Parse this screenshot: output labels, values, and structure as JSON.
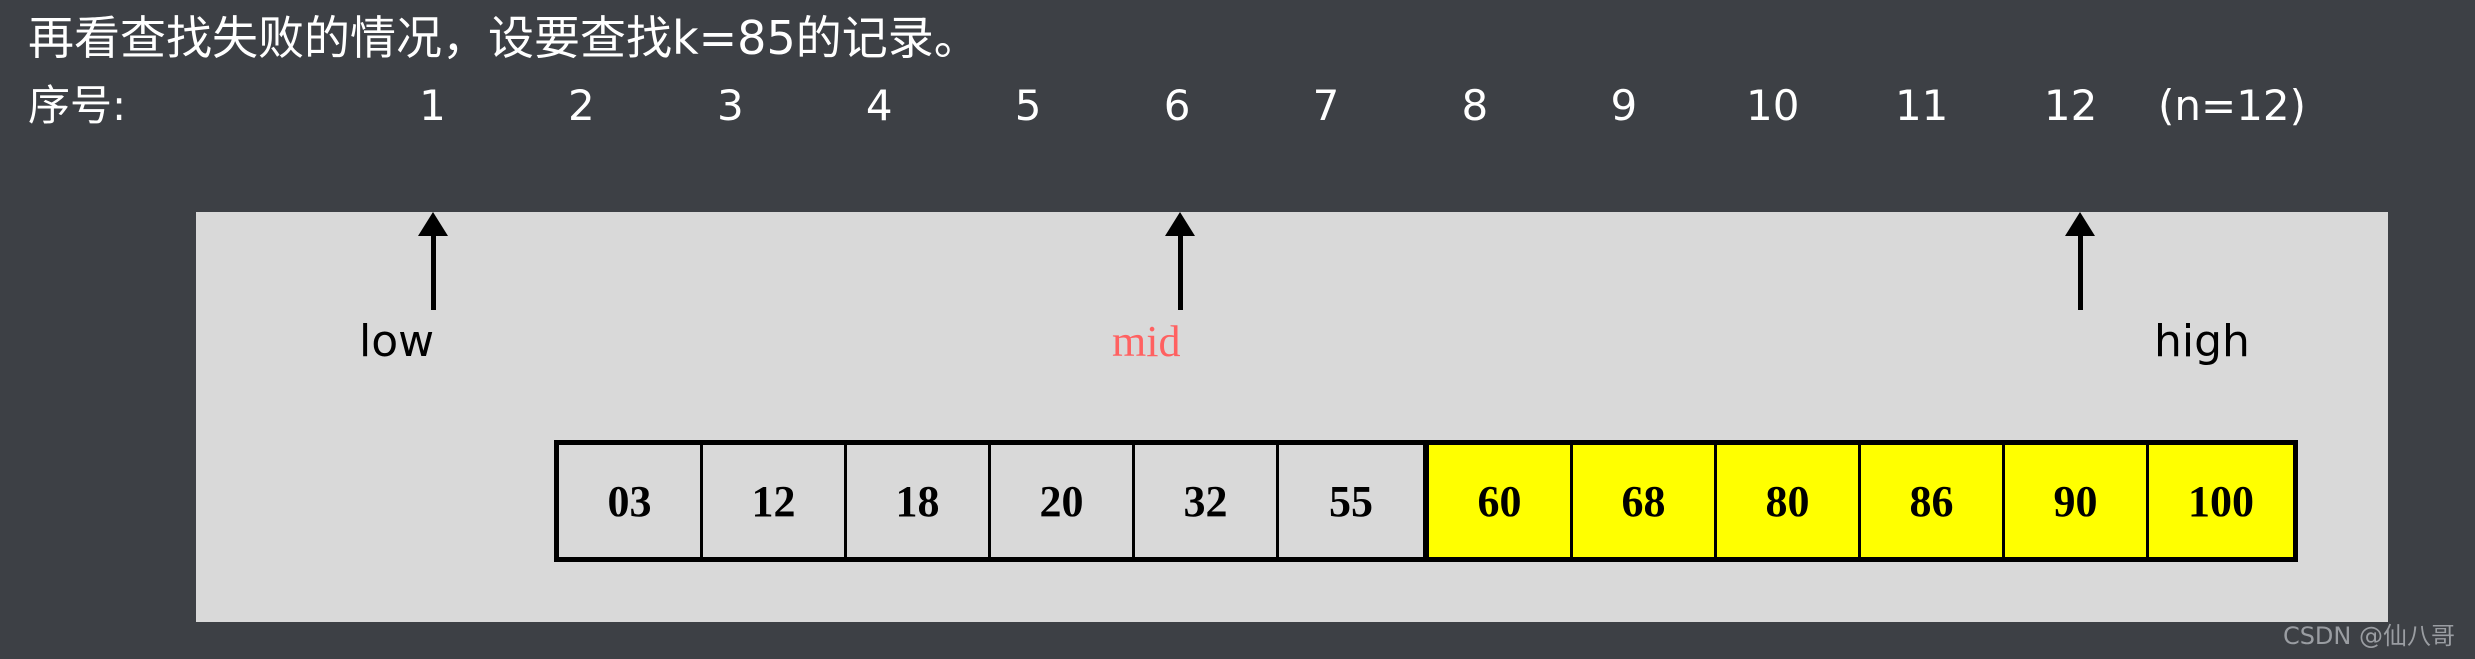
{
  "title": "再看查找失败的情况，设要查找k=85的记录。",
  "index_row": {
    "label": "序号:",
    "numbers": [
      "1",
      "2",
      "3",
      "4",
      "5",
      "6",
      "7",
      "8",
      "9",
      "10",
      "11",
      "12"
    ],
    "suffix": "(n=12)"
  },
  "table": {
    "left_segment": {
      "values": [
        "03",
        "12",
        "18",
        "20",
        "32",
        "55"
      ],
      "fill": "#d9d9d9"
    },
    "right_segment": {
      "values": [
        "60",
        "68",
        "80",
        "86",
        "90",
        "100"
      ],
      "fill": "#ffff00"
    }
  },
  "pointers": [
    {
      "name": "low",
      "label": "low",
      "color": "#000000",
      "index": 1
    },
    {
      "name": "mid",
      "label": "mid",
      "color": "#ff6161",
      "index": 6
    },
    {
      "name": "high",
      "label": "high",
      "color": "#000000",
      "index": 12
    }
  ],
  "watermark": "CSDN @仙八哥",
  "colors": {
    "background": "#3d4045",
    "panel": "#d9d9d9",
    "highlight": "#ffff00",
    "title_text": "#ffffff",
    "mid_text": "#ff6161",
    "border": "#000000"
  }
}
